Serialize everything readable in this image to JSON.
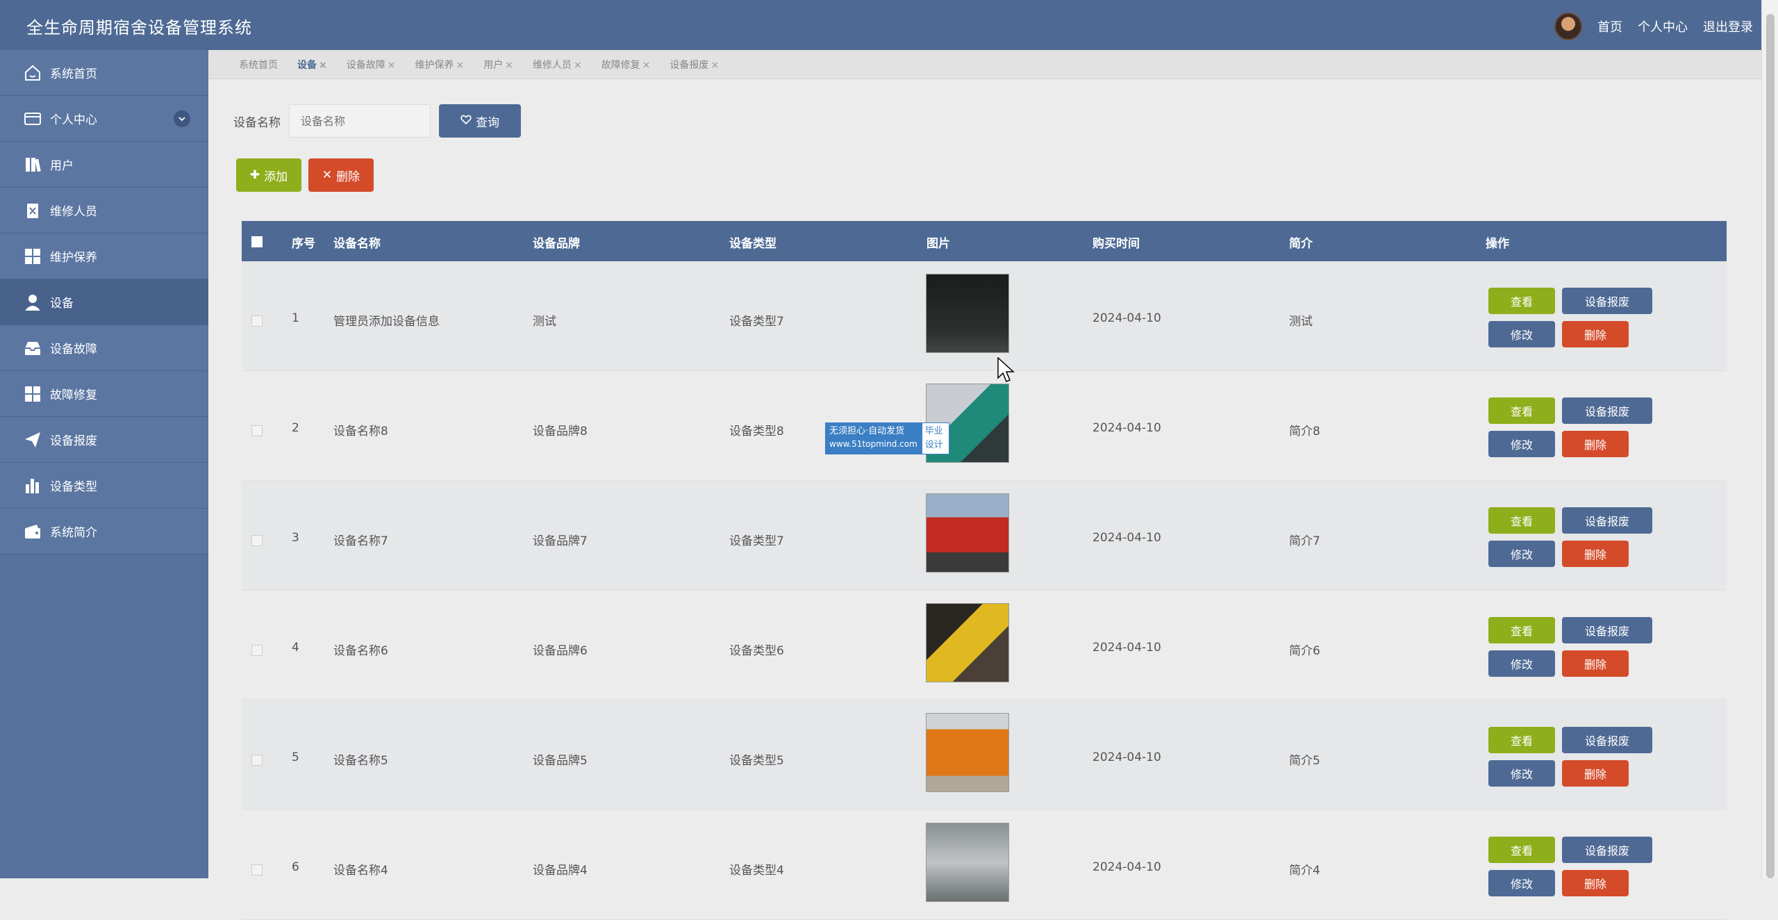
{
  "app": {
    "title": "全生命周期宿舍设备管理系统"
  },
  "header": {
    "links": [
      "首页",
      "个人中心",
      "退出登录"
    ]
  },
  "sidebar": {
    "items": [
      {
        "label": "系统首页",
        "icon": "home-icon"
      },
      {
        "label": "个人中心",
        "icon": "card-icon",
        "expandable": true
      },
      {
        "label": "用户",
        "icon": "book-icon"
      },
      {
        "label": "维修人员",
        "icon": "clipboard-x-icon"
      },
      {
        "label": "维护保养",
        "icon": "grid-icon"
      },
      {
        "label": "设备",
        "icon": "user-icon",
        "active": true
      },
      {
        "label": "设备故障",
        "icon": "inbox-icon"
      },
      {
        "label": "故障修复",
        "icon": "grid-icon"
      },
      {
        "label": "设备报废",
        "icon": "paper-plane-icon"
      },
      {
        "label": "设备类型",
        "icon": "bar-chart-icon"
      },
      {
        "label": "系统简介",
        "icon": "wallet-icon"
      }
    ]
  },
  "tabs": [
    {
      "label": "系统首页",
      "closable": false
    },
    {
      "label": "设备",
      "closable": true,
      "active": true
    },
    {
      "label": "设备故障",
      "closable": true
    },
    {
      "label": "维护保养",
      "closable": true
    },
    {
      "label": "用户",
      "closable": true
    },
    {
      "label": "维修人员",
      "closable": true
    },
    {
      "label": "故障修复",
      "closable": true
    },
    {
      "label": "设备报废",
      "closable": true
    }
  ],
  "search": {
    "label": "设备名称",
    "placeholder": "设备名称",
    "button": "查询"
  },
  "actions": {
    "add": "添加",
    "delete": "删除"
  },
  "table": {
    "headers": [
      "序号",
      "设备名称",
      "设备品牌",
      "设备类型",
      "图片",
      "购买时间",
      "简介",
      "操作"
    ],
    "row_buttons": {
      "view": "查看",
      "scrap": "设备报废",
      "edit": "修改",
      "delete": "删除"
    },
    "rows": [
      {
        "no": "1",
        "name": "管理员添加设备信息",
        "brand": "测试",
        "type": "设备类型7",
        "date": "2024-04-10",
        "intro": "测试"
      },
      {
        "no": "2",
        "name": "设备名称8",
        "brand": "设备品牌8",
        "type": "设备类型8",
        "date": "2024-04-10",
        "intro": "简介8"
      },
      {
        "no": "3",
        "name": "设备名称7",
        "brand": "设备品牌7",
        "type": "设备类型7",
        "date": "2024-04-10",
        "intro": "简介7"
      },
      {
        "no": "4",
        "name": "设备名称6",
        "brand": "设备品牌6",
        "type": "设备类型6",
        "date": "2024-04-10",
        "intro": "简介6"
      },
      {
        "no": "5",
        "name": "设备名称5",
        "brand": "设备品牌5",
        "type": "设备类型5",
        "date": "2024-04-10",
        "intro": "简介5"
      },
      {
        "no": "6",
        "name": "设备名称4",
        "brand": "设备品牌4",
        "type": "设备类型4",
        "date": "2024-04-10",
        "intro": "简介4"
      }
    ]
  },
  "watermark": {
    "line1": "无须担心·自动发货",
    "line2": "www.51topmind.com",
    "badge1": "毕业",
    "badge2": "设计"
  },
  "colors": {
    "primary": "#4e6a94",
    "green": "#8fae1b",
    "red": "#d44b2a"
  }
}
